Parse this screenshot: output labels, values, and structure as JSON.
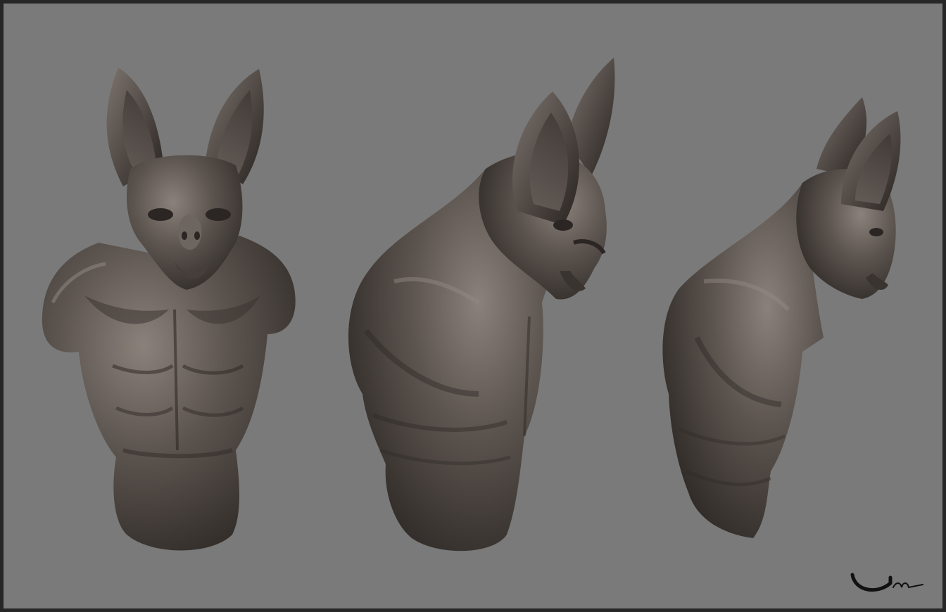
{
  "scene": {
    "background_color": "#7a7a7a",
    "border_color": "#262626",
    "material_color": "#5a524d",
    "views": [
      {
        "name": "front-view",
        "kind": "bat-creature-bust"
      },
      {
        "name": "three-quarter-view",
        "kind": "bat-creature-bust"
      },
      {
        "name": "side-view",
        "kind": "bat-creature-bust"
      }
    ],
    "signature": {
      "text": "Um",
      "style": "handwritten"
    }
  }
}
